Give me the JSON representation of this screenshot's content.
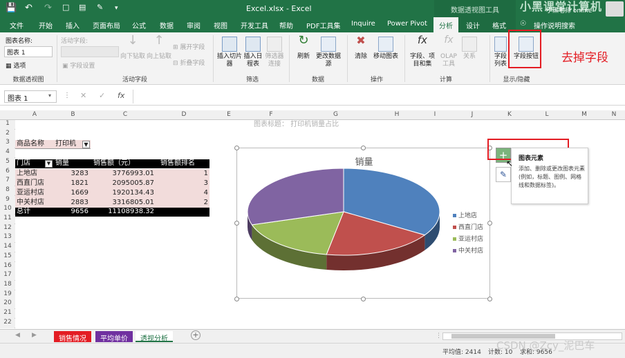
{
  "titlebar": {
    "doc_title": "Excel.xlsx - Excel",
    "context_label": "数据透视图工具",
    "user_name": "小黑老师 online",
    "watermark_top": "小黑课堂计算机"
  },
  "tabs": [
    "文件",
    "开始",
    "插入",
    "页面布局",
    "公式",
    "数据",
    "审阅",
    "视图",
    "开发工具",
    "帮助",
    "PDF工具集",
    "Inquire",
    "Power Pivot",
    "分析",
    "设计",
    "格式",
    "操作说明搜索"
  ],
  "ribbon": {
    "chart_name_label": "图表名称:",
    "chart_name_value": "图表 1",
    "options_label": "选项",
    "active_field_label": "活动字段:",
    "field_settings_label": "字段设置",
    "drill_down_label": "向下钻取",
    "drill_up_label": "向上钻取",
    "expand_field_label": "展开字段",
    "collapse_field_label": "折叠字段",
    "insert_slicer_label": "插入切片器",
    "insert_timeline_label": "插入日程表",
    "filter_connections_label": "筛选器连接",
    "refresh_label": "刷新",
    "change_source_label": "更改数据源",
    "clear_label": "清除",
    "move_chart_label": "移动图表",
    "fields_items_label": "字段、项目和集",
    "olap_label": "OLAP工具",
    "relationships_label": "关系",
    "field_list_label": "字段列表",
    "field_buttons_label": "字段按钮",
    "group_pivotchart": "数据透视图",
    "group_active_field": "活动字段",
    "group_filter": "筛选",
    "group_data": "数据",
    "group_actions": "操作",
    "group_calc": "计算",
    "group_showhide": "显示/隐藏",
    "annotation": "去掉字段"
  },
  "formula_bar": {
    "name_box": "图表 1",
    "fx": "fx"
  },
  "columns": [
    "A",
    "B",
    "C",
    "D",
    "E",
    "F",
    "G",
    "H",
    "I",
    "J",
    "K",
    "L",
    "M",
    "N"
  ],
  "rows": [
    "1",
    "2",
    "3",
    "4",
    "5",
    "6",
    "7",
    "8",
    "9",
    "10",
    "11",
    "12",
    "13",
    "14",
    "15",
    "16",
    "17",
    "18",
    "19",
    "20",
    "21",
    "22"
  ],
  "sheet": {
    "chart_title_hint": "图表标题：  打印机销量占比",
    "filter_label": "商品名称",
    "filter_value": "打印机",
    "headers": [
      "门店",
      "销量",
      "销售额（元）",
      "销售额排名"
    ],
    "data_rows": [
      [
        "上地店",
        "3283",
        "3776993.01",
        "1"
      ],
      [
        "西直门店",
        "1821",
        "2095005.87",
        "3"
      ],
      [
        "亚运村店",
        "1669",
        "1920134.43",
        "4"
      ],
      [
        "中关村店",
        "2883",
        "3316805.01",
        "2"
      ]
    ],
    "total_row": [
      "总计",
      "9656",
      "11108938.32",
      ""
    ]
  },
  "chart_data": {
    "type": "pie",
    "title": "销量",
    "categories": [
      "上地店",
      "西直门店",
      "亚运村店",
      "中关村店"
    ],
    "values": [
      3283,
      1821,
      1669,
      2883
    ],
    "colors": [
      "#4f81bd",
      "#c0504d",
      "#9bbb59",
      "#8064a2"
    ],
    "legend_position": "right",
    "three_d": true
  },
  "chart_elements_popup": {
    "title": "图表元素",
    "description": "添加、删除或更改图表元素(例如，标题、图例、网格线和数据标签)。"
  },
  "sheet_tabs": [
    {
      "label": "销售情况",
      "color": "#e31c23"
    },
    {
      "label": "平均单价",
      "color": "#7030a0"
    },
    {
      "label": "透视分析",
      "color": "#ffffff"
    }
  ],
  "statusbar": {
    "average": "平均值: 2414",
    "count": "计数: 10",
    "sum": "求和: 9656",
    "watermark": "CSDN @Zcy_泥巴车"
  }
}
